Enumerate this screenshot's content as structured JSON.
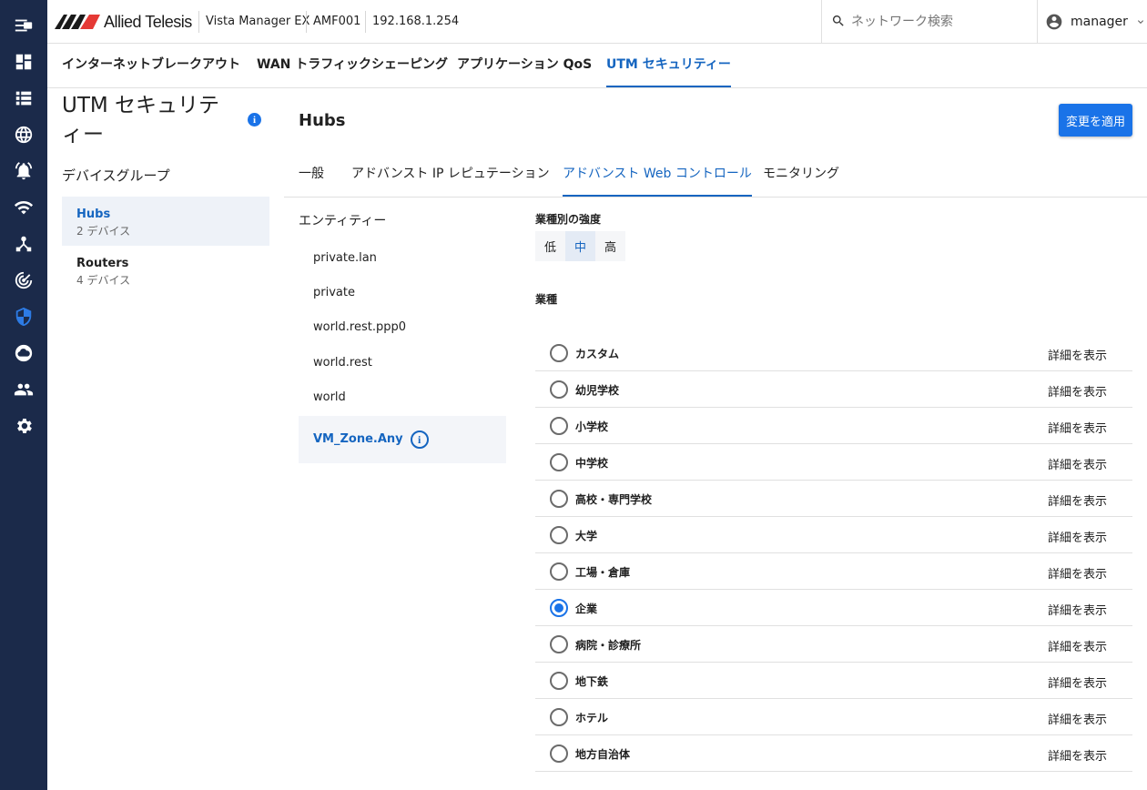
{
  "brand": {
    "logo_text": "Allied Telesis"
  },
  "header": {
    "product": "Vista Manager EX",
    "device": "AMF001",
    "ip": "192.168.1.254",
    "search_placeholder": "ネットワーク検索",
    "user": "manager"
  },
  "sidebar": {
    "icons": [
      "menu-icon",
      "dashboard-icon",
      "list-icon",
      "globe-icon",
      "alarm-icon",
      "wifi-icon",
      "topology-icon",
      "radar-icon",
      "shield-icon",
      "cloud-icon",
      "users-icon",
      "settings-icon"
    ],
    "active": "shield-icon"
  },
  "main_tabs": [
    {
      "label": "インターネットブレークアウト",
      "active": false
    },
    {
      "label": "WAN トラフィックシェーピング",
      "active": false
    },
    {
      "label": "アプリケーション QoS",
      "active": false
    },
    {
      "label": "UTM セキュリティー",
      "active": true
    }
  ],
  "page": {
    "title": "UTM セキュリティー",
    "info_icon": "i",
    "group_title": "デバイスグループ",
    "groups": [
      {
        "name": "Hubs",
        "count": "2 デバイス",
        "active": true
      },
      {
        "name": "Routers",
        "count": "4 デバイス",
        "active": false
      }
    ]
  },
  "hub": {
    "title": "Hubs",
    "apply_label": "変更を適用"
  },
  "sub_tabs": [
    {
      "label": "一般",
      "active": false
    },
    {
      "label": "アドバンスト IP レピュテーション",
      "active": false
    },
    {
      "label": "アドバンスト Web コントロール",
      "active": true
    },
    {
      "label": "モニタリング",
      "active": false
    }
  ],
  "entities": {
    "title": "エンティティー",
    "items": [
      "private.lan",
      "private",
      "world.rest.ppp0",
      "world.rest",
      "world",
      "VM_Zone.Any"
    ],
    "active": "VM_Zone.Any"
  },
  "strength": {
    "label": "業種別の強度",
    "options": [
      "低",
      "中",
      "高"
    ],
    "selected": "中"
  },
  "industries": {
    "label": "業種",
    "detail_label": "詳細を表示",
    "items": [
      "カスタム",
      "幼児学校",
      "小学校",
      "中学校",
      "高校・専門学校",
      "大学",
      "工場・倉庫",
      "企業",
      "病院・診療所",
      "地下鉄",
      "ホテル",
      "地方自治体"
    ],
    "selected": "企業"
  },
  "colors": {
    "sidebar": "#1b2a4a",
    "accent": "#1a73e8",
    "link": "#1565c0"
  }
}
